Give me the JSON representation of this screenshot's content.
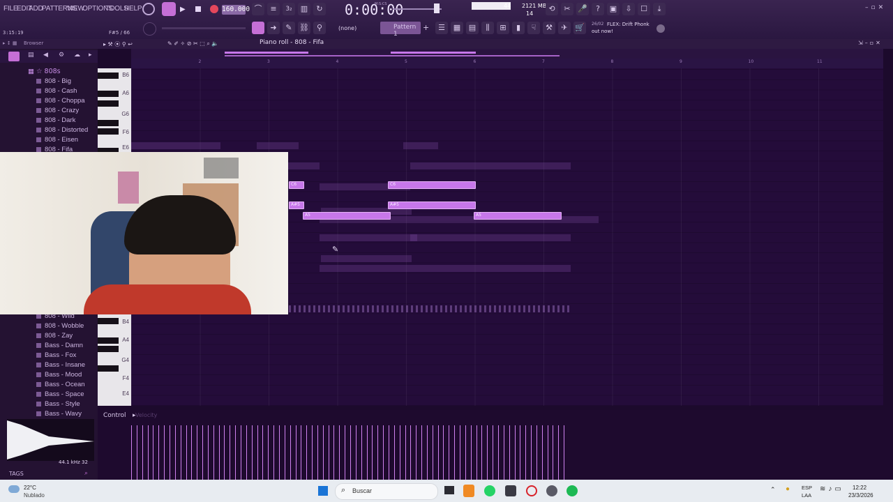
{
  "menu": [
    "FILE",
    "EDIT",
    "ADD",
    "PATTERNS",
    "VIEW",
    "OPTIONS",
    "TOOLS",
    "HELP"
  ],
  "transport": {
    "tempo": "160.000",
    "time": "0:00:00",
    "time_label": "M:S:CS",
    "song_pos": "3:15:19",
    "hint": "F#5 / 66"
  },
  "monitor": {
    "cpu": "44",
    "ram": "2121 MB",
    "voices": "14"
  },
  "pattern": {
    "snap": "(none)",
    "name": "Pattern 1"
  },
  "news": {
    "date": "26/02",
    "line1": "FLEX: Drift Phonk",
    "line2": "out now!"
  },
  "browser": {
    "title": "Browser",
    "folder": "808s",
    "items_top": [
      "808 - Big",
      "808 - Cash",
      "808 - Choppa",
      "808 - Crazy",
      "808 - Dark",
      "808 - Distorted",
      "808 - Eisen",
      "808 - Fifa"
    ],
    "items_bottom": [
      "808 - Wild",
      "808 - Wobble",
      "808 - Zay",
      "Bass - Damn",
      "Bass - Fox",
      "Bass - Insane",
      "Bass - Mood",
      "Bass - Ocean",
      "Bass - Space",
      "Bass - Style",
      "Bass - Wavy"
    ],
    "sample_info": "44.1 kHz 32",
    "tags": "TAGS"
  },
  "piano_roll": {
    "title": "Piano roll - 808 - Fifa",
    "bars": [
      "2",
      "3",
      "4",
      "5",
      "6",
      "7",
      "8",
      "9",
      "10",
      "11"
    ],
    "keys_top": [
      "B6",
      "A6",
      "G6",
      "F6",
      "E6"
    ],
    "keys_bottom": [
      "B4",
      "A4",
      "G4",
      "F4",
      "E4"
    ],
    "notes": [
      "C6",
      "A#5",
      "A5"
    ],
    "control_label": "Control",
    "control_target": "Velocity"
  },
  "taskbar": {
    "weather_temp": "22°C",
    "weather_desc": "Nublado",
    "search": "Buscar",
    "lang1": "ESP",
    "lang2": "LAA",
    "time": "12:22",
    "date": "23/3/2026"
  },
  "colors": {
    "accent": "#c777ea",
    "background": "#240c3a",
    "taskbar": "#e8ecf1"
  }
}
